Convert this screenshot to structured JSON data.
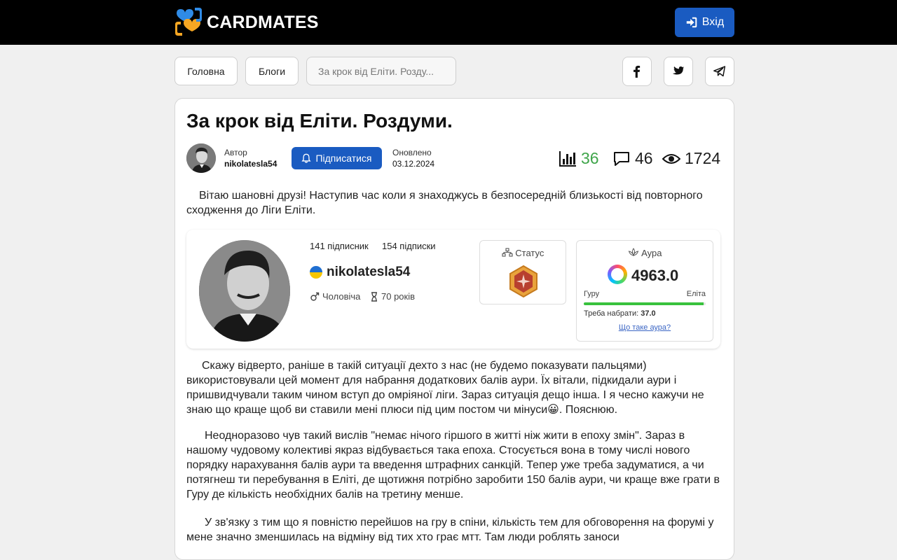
{
  "header": {
    "brand": "CARDMATES",
    "login_label": "Вхід"
  },
  "nav": {
    "breadcrumbs": [
      {
        "label": "Головна"
      },
      {
        "label": "Блоги"
      },
      {
        "label": "За крок від Еліти. Розду..."
      }
    ],
    "share_icons": [
      "facebook-icon",
      "twitter-icon",
      "telegram-icon"
    ]
  },
  "post": {
    "title": "За крок від Еліти. Роздуми.",
    "author_label": "Автор",
    "author": "nikolatesla54",
    "subscribe_label": "Підписатися",
    "updated_label": "Оновлено",
    "updated_date": "03.12.2024",
    "stats": {
      "rating": "36",
      "comments": "46",
      "views": "1724"
    },
    "intro": "Вітаю шановні друзі! Наступив час коли я знаходжусь в безпосередній близькості від повторного сходження до Ліги Еліти.",
    "paragraphs": [
      "Скажу відверто, раніше в такій ситуації дехто з нас (не будемо показувати пальцями) використовували цей момент для набрання додаткових балів аури. Їх вітали, підкидали аури і пришвидчували таким чином вступ до омріяної ліги. Зараз ситуація дещо інша. І я чесно кажучи не знаю що краще щоб ви ставили мені плюси під цим постом чи мінуси😀. Пояснюю.",
      "Неодноразово чув такий вислів \"немає нічого гіршого в житті ніж жити в епоху змін\". Зараз в нашому чудовому колективі якраз відбувається така епоха. Стосується вона в тому числі нового порядку нарахування балів аури та введення штрафних санкцій.  Тепер уже треба задуматися, а чи потягнеш ти перебування в Еліті, де щотижня потрібно заробити 150 балів аури, чи краще вже грати в Гуру де кількість необхідних балів на третину менше.",
      "У зв'язку з тим що я повністю перейшов на гру в спіни, кількість тем для обговорення на форумі у мене значно зменшилась на відміну від тих хто грає мтт. Там люди роблять заноси"
    ]
  },
  "profile": {
    "followers": "141 підписник",
    "following": "154 підписки",
    "name": "nikolatesla54",
    "gender": "Чоловіча",
    "age": "70 років",
    "status_title": "Статус",
    "aura_title": "Аура",
    "aura_value": "4963.0",
    "level_from": "Гуру",
    "level_to": "Еліта",
    "progress_fraction": 0.98,
    "need_label": "Треба набрати:",
    "need_value": "37.0",
    "aura_link": "Що таке аура?"
  },
  "colors": {
    "accent": "#1a5bc1",
    "rating_green": "#3fa54a",
    "progress_green": "#38c23d"
  }
}
